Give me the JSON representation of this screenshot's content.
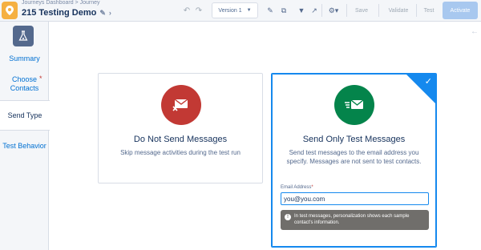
{
  "header": {
    "breadcrumb": "Journeys Dashboard > Journey",
    "title": "215 Testing Demo",
    "version_label": "Version 1",
    "buttons": {
      "save": "Save",
      "validate": "Validate",
      "test": "Test",
      "activate": "Activate"
    }
  },
  "sidebar": {
    "items": [
      {
        "label": "Summary"
      },
      {
        "label": "Choose Contacts"
      },
      {
        "label": "Send Type"
      },
      {
        "label": "Test Behavior"
      }
    ]
  },
  "cards": {
    "no_send": {
      "title": "Do Not Send Messages",
      "description": "Skip message activities during the test run"
    },
    "test_only": {
      "title": "Send Only Test Messages",
      "description": "Send test messages to the email address you specify. Messages are not sent to test contacts.",
      "email_label": "Email Address",
      "email_required": "*",
      "email_value": "you@you.com",
      "info": "In test messages, personalization shows each sample contact's information."
    }
  },
  "colors": {
    "accent": "#1589ee",
    "red": "#c23934",
    "green": "#04844b",
    "activate_bg": "#a8c8ef"
  },
  "icons": [
    "journey-icon",
    "edit-icon",
    "chevron-right-icon",
    "undo-icon",
    "redo-icon",
    "pencil-icon",
    "copy-icon",
    "filter-icon",
    "export-icon",
    "settings-icon",
    "flask-icon",
    "no-send-email-icon",
    "send-email-icon",
    "checkmark-icon",
    "info-icon",
    "collapse-icon"
  ]
}
